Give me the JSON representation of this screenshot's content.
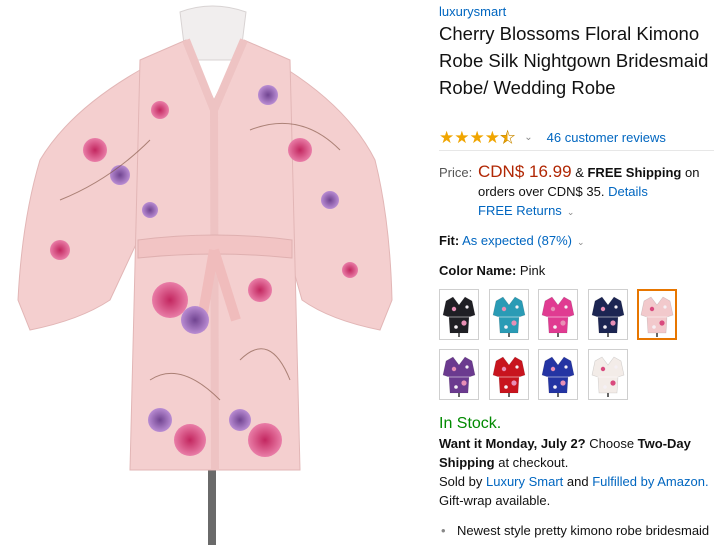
{
  "product": {
    "brand": "luxurysmart",
    "title": "Cherry Blossoms Floral Kimono Robe Silk Nightgown Bridesmaid Robe/ Wedding Robe",
    "image_alt_icon": "kimono-robe-image"
  },
  "rating": {
    "stars": 4.5,
    "chevron": "⌄",
    "reviews_text": "46 customer reviews"
  },
  "price": {
    "label": "Price:",
    "value": "CDN$ 16.99",
    "amp": "&",
    "free_shipping": "FREE Shipping",
    "on_text": " on orders over CDN$ 35.",
    "details_link": "Details",
    "free_returns": "FREE Returns"
  },
  "fit": {
    "label": "Fit:",
    "value": "As expected (87%)"
  },
  "color": {
    "label": "Color Name:",
    "value": "Pink",
    "selected_index": 4,
    "swatches": [
      {
        "name": "Black",
        "hex": "#1f1f24"
      },
      {
        "name": "Teal",
        "hex": "#2a9bb5"
      },
      {
        "name": "Rose Pink",
        "hex": "#e03b91"
      },
      {
        "name": "Navy",
        "hex": "#1c2552"
      },
      {
        "name": "Pink",
        "hex": "#f2c9cc"
      },
      {
        "name": "Purple",
        "hex": "#6b3a8f"
      },
      {
        "name": "Red",
        "hex": "#c8141e"
      },
      {
        "name": "Blue",
        "hex": "#2434a3"
      },
      {
        "name": "White",
        "hex": "#f3ece8"
      }
    ]
  },
  "stock": {
    "in_stock": "In Stock.",
    "want_it": "Want it Monday, July 2?",
    "choose": " Choose ",
    "two_day": "Two-Day Shipping",
    "at_checkout": " at checkout.",
    "sold_by": "Sold by ",
    "seller": "Luxury Smart",
    "and": " and ",
    "fulfilled": "Fulfilled by Amazon.",
    "gift_wrap": "Gift-wrap available."
  },
  "bullets": [
    "Newest style pretty kimono robe bridesmaid"
  ],
  "colors": {
    "link": "#0066c0",
    "price": "#b12704",
    "in_stock": "#008a00",
    "selected_border": "#e77600",
    "star": "#f0a500",
    "robe_base": "#f4cfcf"
  }
}
